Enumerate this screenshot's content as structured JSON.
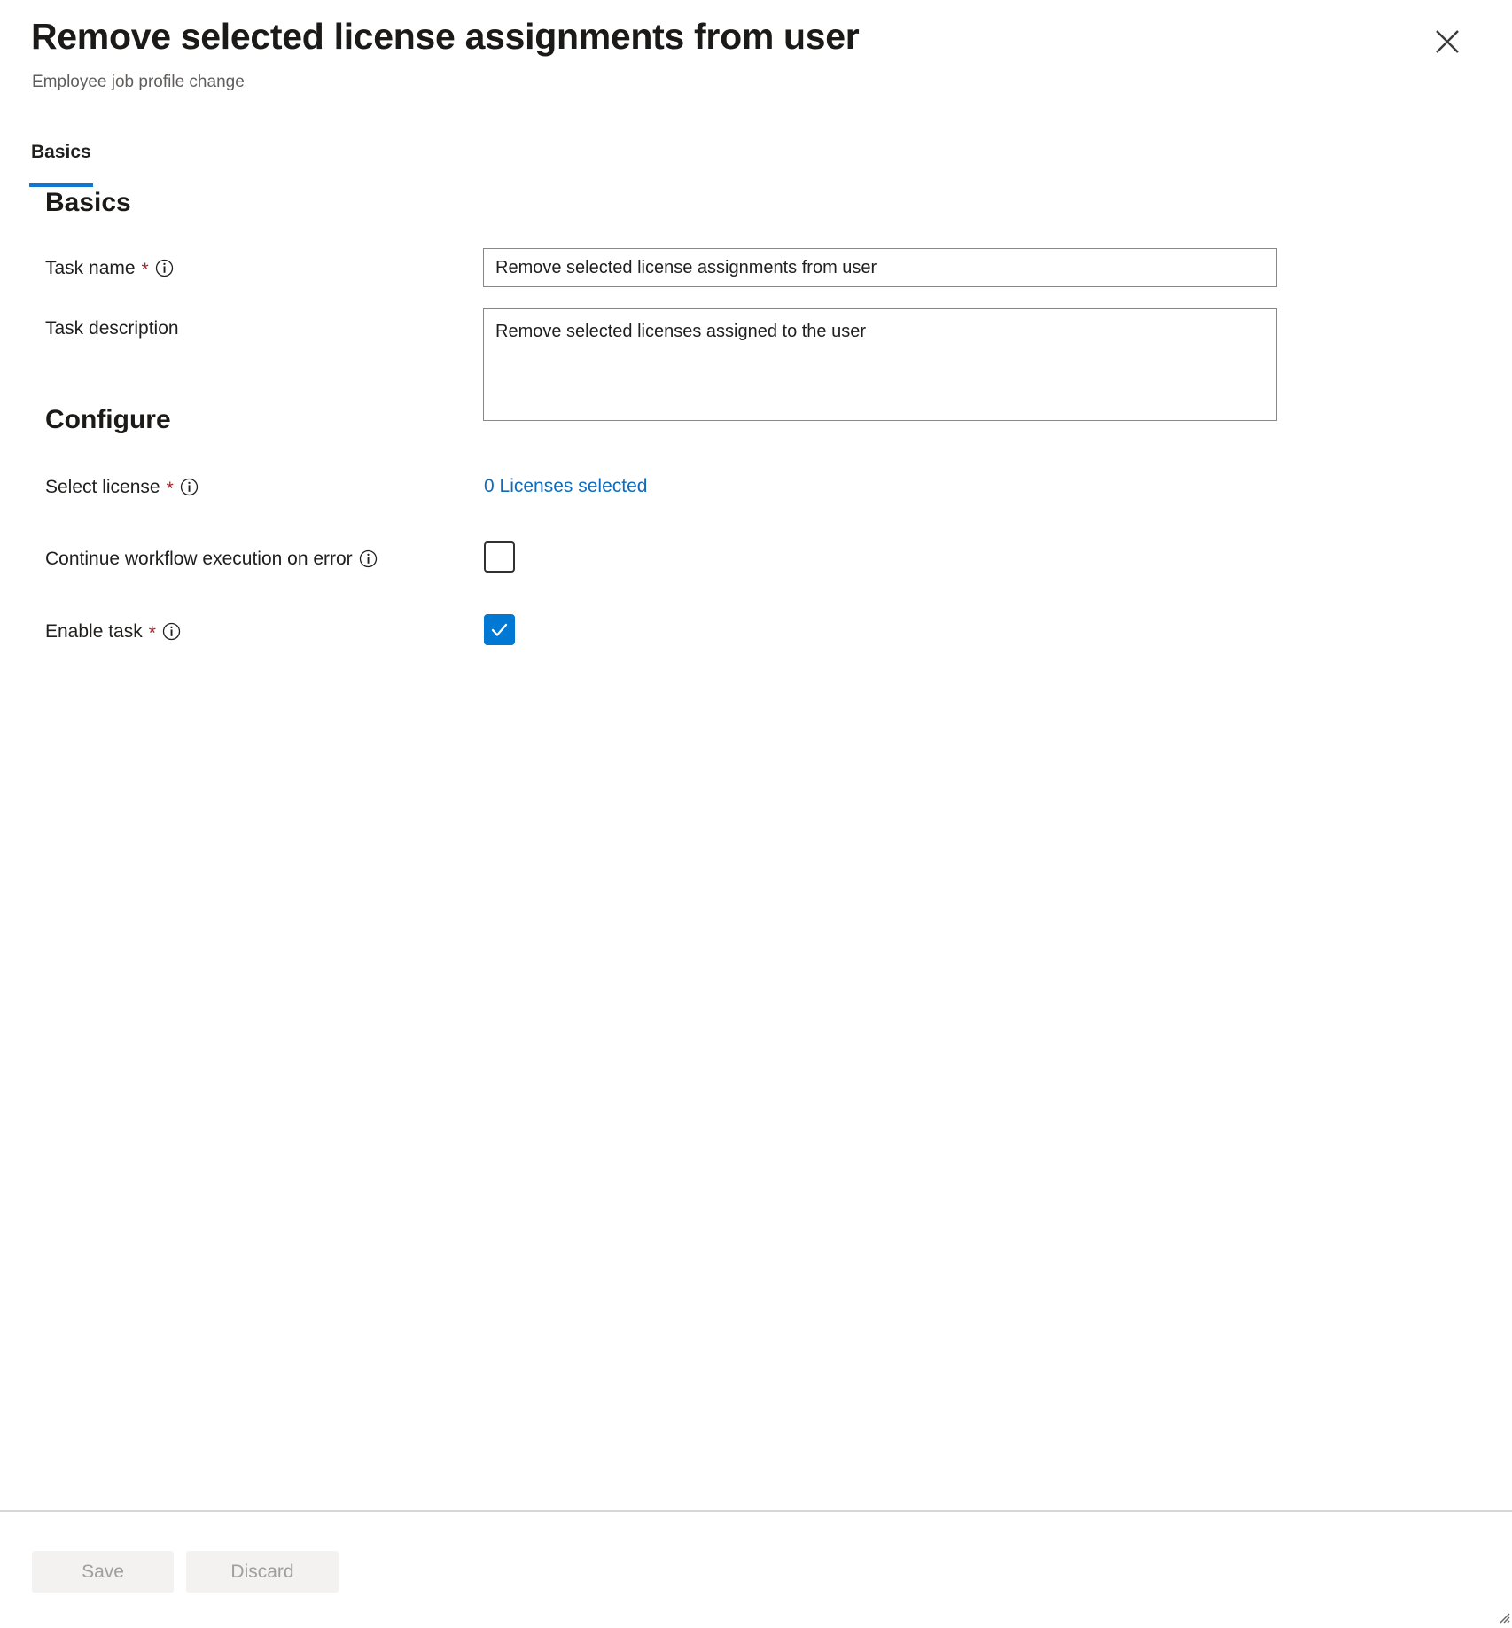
{
  "header": {
    "title": "Remove selected license assignments from user",
    "subtitle": "Employee job profile change",
    "close_label": "Close",
    "close_icon": "close-icon"
  },
  "tabs": [
    {
      "label": "Basics",
      "selected": true
    }
  ],
  "sections": {
    "basics": {
      "heading": "Basics",
      "fields": [
        {
          "label": "Task name",
          "required_marker": "*",
          "info_icon": "info-circle-icon",
          "value": "Remove selected license assignments from user",
          "placeholder": "Task name"
        },
        {
          "label": "Task description",
          "required_marker": "",
          "info_icon": "",
          "value": "Remove selected licenses assigned to the user",
          "placeholder": "Task description"
        }
      ]
    },
    "configure": {
      "heading": "Configure",
      "fields": [
        {
          "label": "Select license",
          "required_marker": "*",
          "info_icon": "info-circle-icon",
          "link_text": "0 Licenses selected"
        },
        {
          "label": "Continue workflow execution on error",
          "required_marker": "",
          "info_icon": "info-circle-icon",
          "checked": false
        },
        {
          "label": "Enable task",
          "required_marker": "*",
          "info_icon": "info-circle-icon",
          "checked": true
        }
      ]
    }
  },
  "footer": {
    "save_label": "Save",
    "discard_label": "Discard"
  },
  "colors": {
    "accent": "#0078d4",
    "tab_underline": "#0f76d1",
    "link": "#0f6cbd",
    "required": "#a4262c",
    "text": "#201f1e",
    "subtitle": "#605e5c",
    "field_border": "#8a8886",
    "footer_button_bg": "#f3f2f1",
    "footer_button_text": "#a19f9d"
  }
}
